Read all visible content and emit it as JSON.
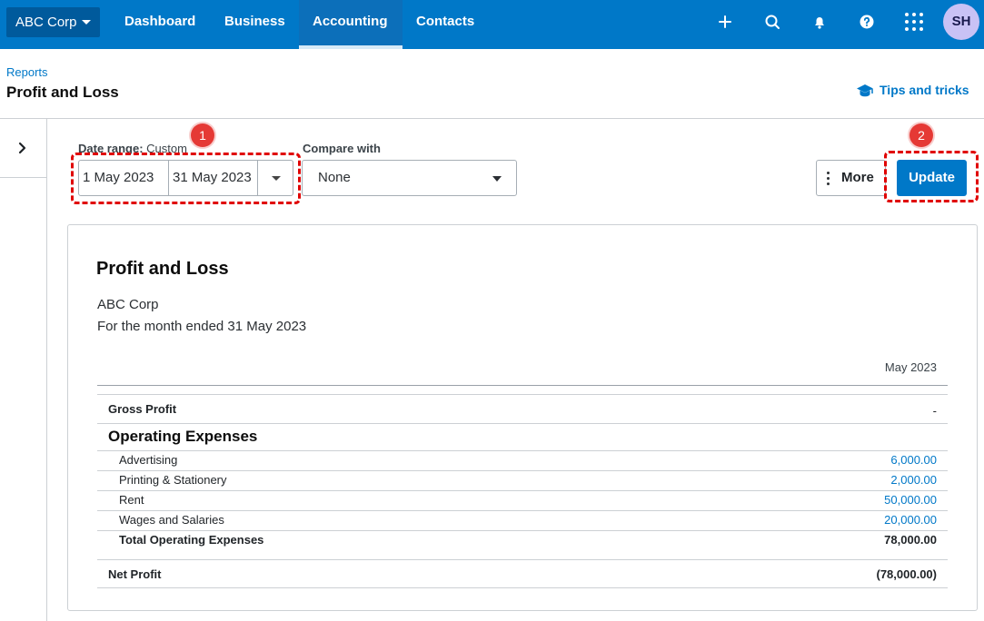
{
  "nav": {
    "org_name": "ABC Corp",
    "items": [
      {
        "label": "Dashboard"
      },
      {
        "label": "Business"
      },
      {
        "label": "Accounting"
      },
      {
        "label": "Contacts"
      }
    ],
    "active_item": "Accounting",
    "icons": [
      "plus-icon",
      "search-icon",
      "bell-icon",
      "help-icon",
      "apps-grid-icon"
    ],
    "avatar_initials": "SH"
  },
  "header": {
    "breadcrumb": "Reports",
    "title": "Profit and Loss",
    "tips_label": "Tips and tricks"
  },
  "controls": {
    "date_range_label": "Date range:",
    "date_range_mode": "Custom",
    "start_date": "1 May 2023",
    "end_date": "31 May 2023",
    "compare_label": "Compare with",
    "compare_value": "None",
    "more_label": "More",
    "update_label": "Update"
  },
  "annotations": [
    {
      "number": "1"
    },
    {
      "number": "2"
    }
  ],
  "report": {
    "title": "Profit and Loss",
    "org": "ABC Corp",
    "period": "For the month ended 31 May 2023",
    "column_header": "May 2023",
    "gross_profit_label": "Gross Profit",
    "gross_profit_value": "-",
    "opex_heading": "Operating Expenses",
    "expenses": [
      {
        "label": "Advertising",
        "value": "6,000.00"
      },
      {
        "label": "Printing & Stationery",
        "value": "2,000.00"
      },
      {
        "label": "Rent",
        "value": "50,000.00"
      },
      {
        "label": "Wages and Salaries",
        "value": "20,000.00"
      }
    ],
    "total_opex_label": "Total Operating Expenses",
    "total_opex_value": "78,000.00",
    "net_profit_label": "Net Profit",
    "net_profit_value": "(78,000.00)"
  },
  "colors": {
    "brand_blue": "#0078c8",
    "org_button": "#005a9c",
    "annotation_red": "#e00000",
    "avatar_bg": "#c9c2f5"
  }
}
